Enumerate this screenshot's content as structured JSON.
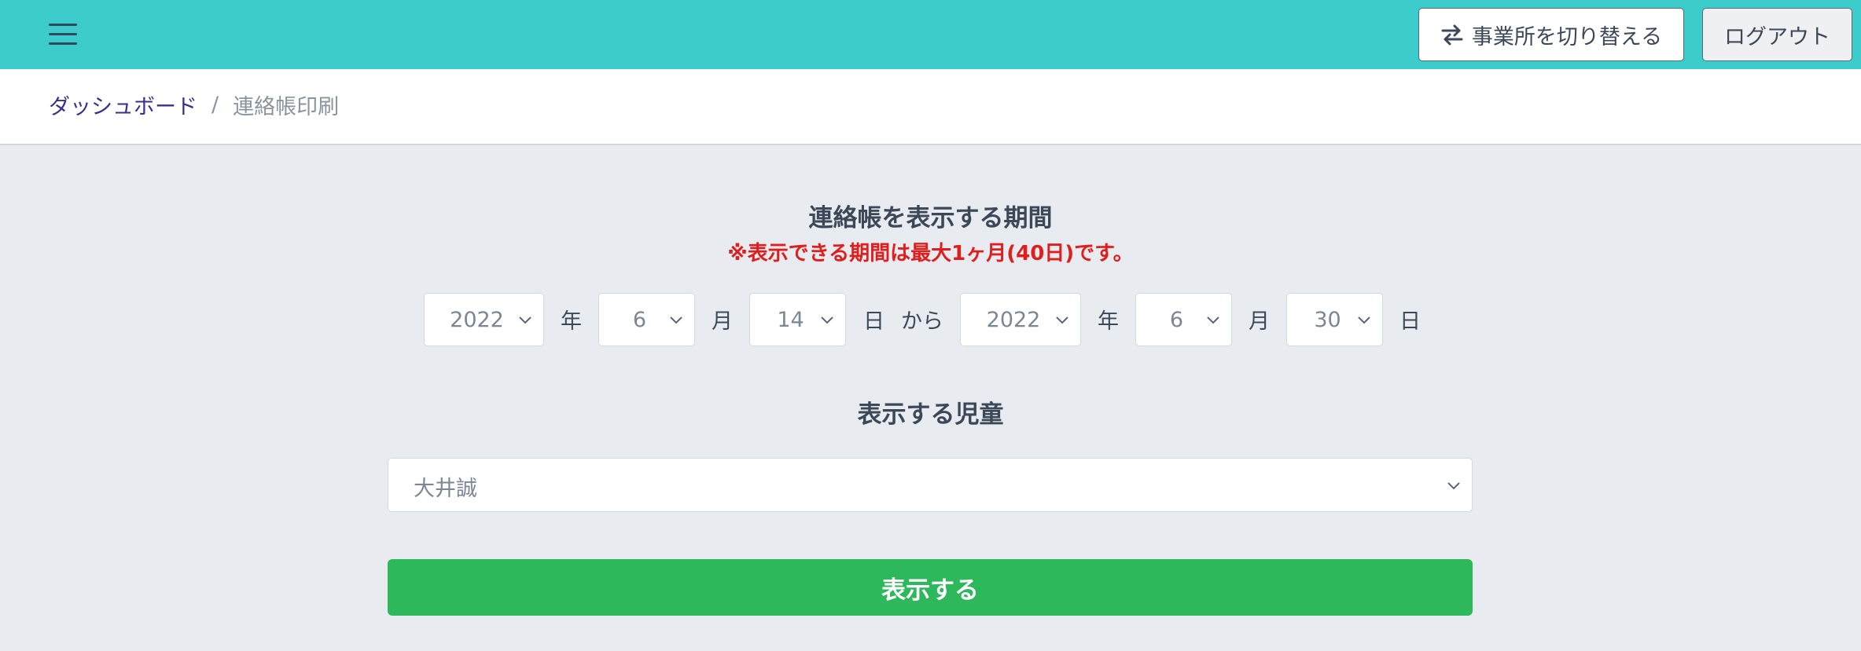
{
  "header": {
    "switch_office_label": "事業所を切り替える",
    "logout_label": "ログアウト"
  },
  "breadcrumb": {
    "home": "ダッシュボード",
    "separator": "/",
    "current": "連絡帳印刷"
  },
  "period": {
    "title": "連絡帳を表示する期間",
    "note": "※表示できる期間は最大1ヶ月(40日)です。",
    "from": {
      "year": "2022",
      "month": "6",
      "day": "14"
    },
    "to": {
      "year": "2022",
      "month": "6",
      "day": "30"
    },
    "units": {
      "year": "年",
      "month": "月",
      "day": "日",
      "from": "から"
    }
  },
  "child": {
    "title": "表示する児童",
    "selected": "大井誠"
  },
  "submit_label": "表示する",
  "colors": {
    "topbar": "#3ccccc",
    "submit": "#2eb85c",
    "note": "#e01e1e"
  }
}
